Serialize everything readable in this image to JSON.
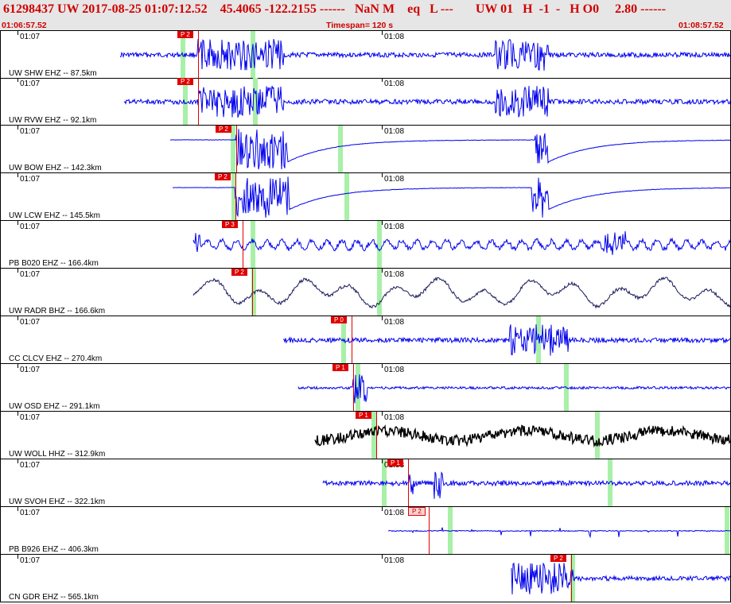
{
  "header": {
    "event_line": "61298437 UW 2017-08-25 01:07:12.52    45.4065 -122.2155 ------   NaN M    eq   L ---       UW 01   H  -1  -   H O0     2.80 ------",
    "start_time": "01:06:57.52",
    "timespan": "Timespan= 120 s",
    "end_time": "01:08:57.52"
  },
  "tick_labels": {
    "left": "01:07",
    "right": "01:08"
  },
  "colors": {
    "header_text": "#d00000",
    "pick": "#e00000",
    "window": "#a8f0a8",
    "trace_blue": "#0000ee",
    "trace_dark": "#1a1a5a",
    "trace_black": "#000000"
  },
  "traces": [
    {
      "label": "UW SHW EHZ -- 87.5km",
      "pick": "P 2"
    },
    {
      "label": "UW RVW EHZ -- 92.1km",
      "pick": "P 2"
    },
    {
      "label": "UW BOW EHZ -- 142.3km",
      "pick": "P 2"
    },
    {
      "label": "UW LCW EHZ -- 145.5km",
      "pick": "P 2"
    },
    {
      "label": "PB B020 EHZ -- 166.4km",
      "pick": "P 3"
    },
    {
      "label": "UW RADR BHZ -- 166.6km",
      "pick": "P 2"
    },
    {
      "label": "CC CLCV EHZ -- 270.4km",
      "pick": "P 0"
    },
    {
      "label": "UW OSD EHZ -- 291.1km",
      "pick": "P 1"
    },
    {
      "label": "UW WOLL HHZ -- 312.9km",
      "pick": "P 1"
    },
    {
      "label": "UW SVOH EHZ -- 322.1km",
      "pick": "P 1"
    },
    {
      "label": "PB B926 EHZ -- 406.3km",
      "pick": "P 2"
    },
    {
      "label": "CN GDR EHZ -- 565.1km",
      "pick": "P 2"
    }
  ]
}
